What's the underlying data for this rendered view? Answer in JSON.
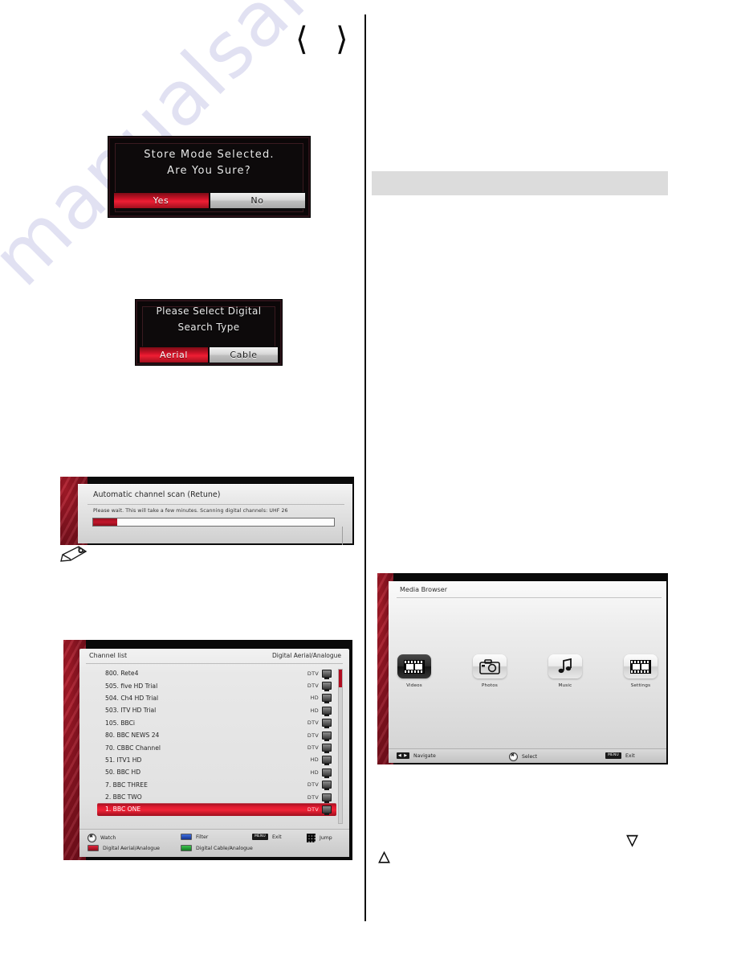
{
  "watermark": {
    "text": "manualsarchive.com"
  },
  "top_nav": {
    "prev_icon": "chevron-left-icon",
    "next_icon": "chevron-right-icon"
  },
  "bottom_nav": {
    "up_icon": "chevron-up-icon",
    "down_icon": "chevron-down-icon"
  },
  "store_mode_dialog": {
    "message_line1": "Store Mode Selected.",
    "message_line2": "Are You Sure?",
    "confirm_label": "Yes",
    "cancel_label": "No",
    "selected": "Yes"
  },
  "search_type_dialog": {
    "message": "Please Select Digital Search Type",
    "option_a": "Aerial",
    "option_b": "Cable",
    "selected": "Aerial"
  },
  "scan_panel": {
    "title": "Automatic channel scan (Retune)",
    "status": "Please wait. This will take a few minutes. Scanning digital channels: UHF 26",
    "progress_percent": 10
  },
  "note_icon": {
    "name": "pencil-note-icon"
  },
  "channel_list": {
    "title": "Channel list",
    "source_label": "Digital Aerial/Analogue",
    "rows": [
      {
        "name": "1. BBC ONE",
        "type": "DTV",
        "selected": true
      },
      {
        "name": "2. BBC TWO",
        "type": "DTV",
        "selected": false
      },
      {
        "name": "7. BBC THREE",
        "type": "DTV",
        "selected": false
      },
      {
        "name": "50. BBC HD",
        "type": "HD",
        "selected": false
      },
      {
        "name": "51. ITV1 HD",
        "type": "HD",
        "selected": false
      },
      {
        "name": "70. CBBC Channel",
        "type": "DTV",
        "selected": false
      },
      {
        "name": "80. BBC NEWS 24",
        "type": "DTV",
        "selected": false
      },
      {
        "name": "105. BBCi",
        "type": "DTV",
        "selected": false
      },
      {
        "name": "503. ITV HD Trial",
        "type": "HD",
        "selected": false
      },
      {
        "name": "504. Ch4 HD Trial",
        "type": "HD",
        "selected": false
      },
      {
        "name": "505. five HD Trial",
        "type": "DTV",
        "selected": false
      },
      {
        "name": "800. Rete4",
        "type": "DTV",
        "selected": false
      }
    ],
    "actions": [
      {
        "key": "ok",
        "label": "Watch"
      },
      {
        "key": "blue",
        "label": "Filter"
      },
      {
        "key": "menu",
        "label": "Exit",
        "key_label": "MENU"
      },
      {
        "key": "numpad",
        "label": "Jump"
      },
      {
        "key": "red",
        "label": "Digital Aerial/Analogue"
      },
      {
        "key": "green",
        "label": "Digital Cable/Analogue"
      }
    ]
  },
  "media_browser": {
    "title": "Media Browser",
    "items": [
      {
        "label": "Videos",
        "icon": "film-strip-icon",
        "selected": true
      },
      {
        "label": "Photos",
        "icon": "camera-icon",
        "selected": false
      },
      {
        "label": "Music",
        "icon": "music-note-icon",
        "selected": false
      },
      {
        "label": "Settings",
        "icon": "film-strip-icon",
        "selected": false
      }
    ],
    "actions": [
      {
        "key": "arrows",
        "label": "Navigate",
        "key_label": "◀ ▶"
      },
      {
        "key": "ok",
        "label": "Select"
      },
      {
        "key": "menu",
        "label": "Exit",
        "key_label": "MENU"
      }
    ]
  },
  "colors": {
    "accent_red": "#d6142a",
    "dark_bg": "#0b0708",
    "panel_grey": "#dcdcdc"
  }
}
